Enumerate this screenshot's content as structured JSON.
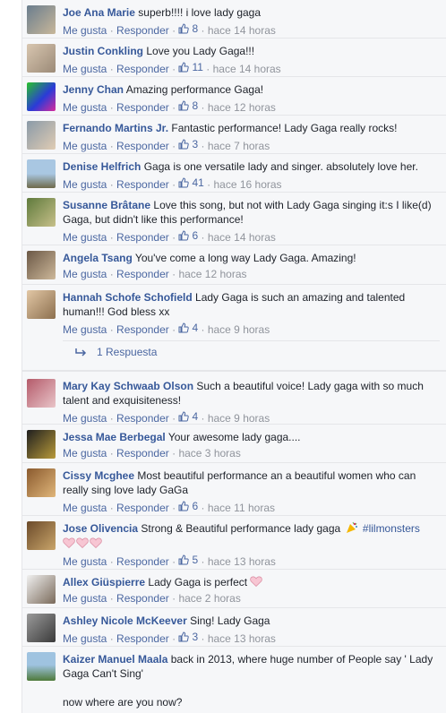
{
  "actions": {
    "like": "Me gusta",
    "reply": "Responder",
    "sep": "·"
  },
  "comments": [
    {
      "author": "Joe Ana Marie",
      "text": "superb!!!! i love lady gaga",
      "likes": "8",
      "time": "hace 14 horas"
    },
    {
      "author": "Justin Conkling",
      "text": "Love you Lady Gaga!!!",
      "likes": "11",
      "time": "hace 14 horas"
    },
    {
      "author": "Jenny Chan",
      "text": "Amazing performance Gaga!",
      "likes": "8",
      "time": "hace 12 horas"
    },
    {
      "author": "Fernando Martins Jr.",
      "text": "Fantastic performance! Lady Gaga really rocks!",
      "likes": "3",
      "time": "hace 7 horas"
    },
    {
      "author": "Denise Helfrich",
      "text": "Gaga is one versatile lady and singer. absolutely love her.",
      "likes": "41",
      "time": "hace 16 horas"
    },
    {
      "author": "Susanne Brâtane",
      "text": "Love this song, but not with Lady Gaga singing it:s I like(d) Gaga, but didn't like this performance!",
      "likes": "6",
      "time": "hace 14 horas"
    },
    {
      "author": "Angela Tsang",
      "text": "You've come a long way Lady Gaga. Amazing!",
      "likes": "",
      "time": "hace 12 horas"
    },
    {
      "author": "Hannah Schofe Schofield",
      "text": "Lady Gaga is such an amazing and talented human!!! God bless xx",
      "likes": "4",
      "time": "hace 9 horas",
      "replies": "1 Respuesta"
    },
    {
      "author": "Mary Kay Schwaab Olson",
      "text": "Such a beautiful voice! Lady gaga with so much talent and exquisiteness!",
      "likes": "4",
      "time": "hace 9 horas"
    },
    {
      "author": "Jessa Mae Berbegal",
      "text": "Your awesome lady gaga....",
      "likes": "",
      "time": "hace 3 horas"
    },
    {
      "author": "Cissy Mcghee",
      "text": "Most beautiful performance an a beautiful women who can really sing love lady GaGa",
      "likes": "6",
      "time": "hace 11 horas"
    },
    {
      "author": "Jose Olivencia",
      "text": "Strong & Beautiful performance lady gaga",
      "hashtag": "#lilmonsters",
      "likes": "5",
      "time": "hace 13 horas"
    },
    {
      "author": "Allex Giüspierre",
      "text": "Lady Gaga is perfect",
      "likes": "",
      "time": "hace 2 horas"
    },
    {
      "author": "Ashley Nicole McKeever",
      "text": "Sing! Lady Gaga",
      "likes": "3",
      "time": "hace 13 horas"
    },
    {
      "author": "Kaizer Manuel Maala",
      "text": "back in 2013, where huge number of People say ' Lady Gaga Can't Sing'",
      "text2": "now where are you now?"
    }
  ],
  "colors": {
    "link": "#365899",
    "meta": "#90949c",
    "heart": "#f7b6c7"
  },
  "icons": [
    "thumbs-up-icon",
    "heart-icon",
    "party-popper-icon",
    "reply-arrow-icon"
  ]
}
